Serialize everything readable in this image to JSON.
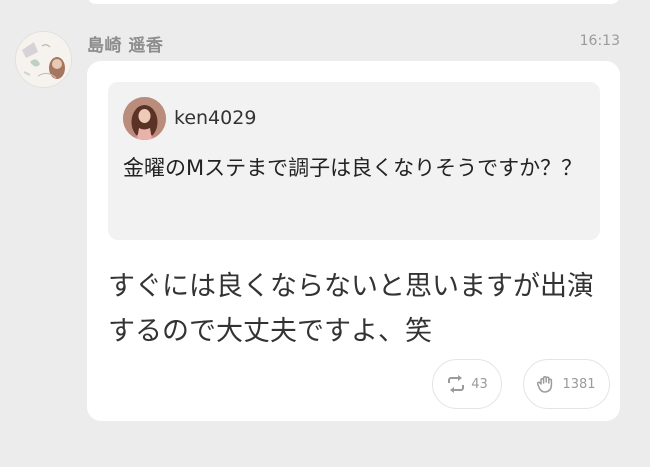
{
  "post": {
    "author_name": "島崎 遥香",
    "timestamp": "16:13",
    "reply_text": "すぐには良くならないと思いますが出演するので大丈夫ですよ、笑",
    "quoted": {
      "username": "ken4029",
      "text": "金曜のMステまで調子は良くなりそうですか？？"
    },
    "actions": {
      "repost_icon": "repost-icon",
      "repost_count": "43",
      "like_icon": "clap-hand-icon",
      "like_count": "1381"
    }
  },
  "colors": {
    "background": "#ececec",
    "card": "#ffffff",
    "quote_bg": "#f2f2f2",
    "muted_text": "#9b9b9b"
  }
}
